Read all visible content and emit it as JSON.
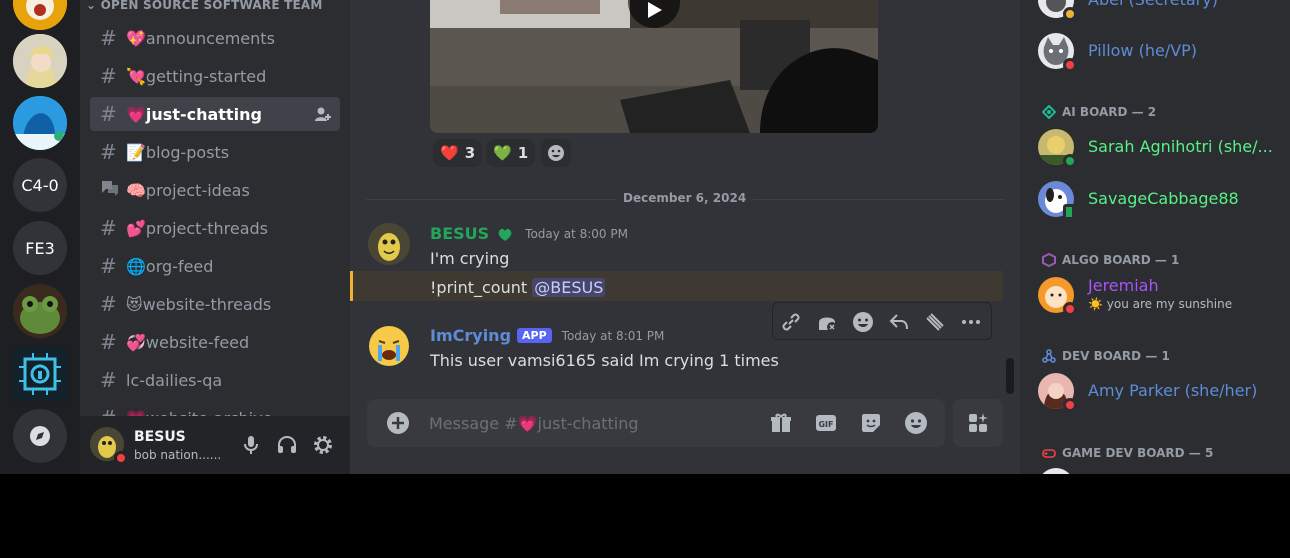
{
  "rail": {
    "servers": [
      {
        "name": "server-orange-avatar",
        "label": ""
      },
      {
        "name": "server-anime-avatar",
        "label": ""
      },
      {
        "name": "server-blue-avatar",
        "label": ""
      },
      {
        "name": "server-c40",
        "label": "C4-0"
      },
      {
        "name": "server-fe3",
        "label": "FE3"
      },
      {
        "name": "server-frog-avatar",
        "label": ""
      },
      {
        "name": "server-circuit-avatar",
        "label": ""
      }
    ]
  },
  "sidebar": {
    "category": "OPEN SOURCE SOFTWARE TEAM",
    "channels": [
      {
        "label": "💖announcements",
        "icon": "hash-icon"
      },
      {
        "label": "💘getting-started",
        "icon": "hash-icon"
      },
      {
        "label": "💗just-chatting",
        "icon": "hash-icon",
        "active": true
      },
      {
        "label": "📝blog-posts",
        "icon": "hash-icon"
      },
      {
        "label": "🧠project-ideas",
        "icon": "forum-icon"
      },
      {
        "label": "💕project-threads",
        "icon": "hash-icon"
      },
      {
        "label": "🌐org-feed",
        "icon": "hash-icon"
      },
      {
        "label": "😻website-threads",
        "icon": "hash-icon"
      },
      {
        "label": "💞website-feed",
        "icon": "hash-icon"
      },
      {
        "label": "lc-dailies-qa",
        "icon": "hash-icon"
      },
      {
        "label": "💗website-archive",
        "icon": "hash-icon"
      }
    ]
  },
  "user": {
    "name": "BESUS",
    "status": "bob nation......"
  },
  "chat": {
    "reactions": [
      {
        "emoji": "❤️",
        "count": "3"
      },
      {
        "emoji": "💚",
        "count": "1"
      }
    ],
    "date_divider": "December 6, 2024",
    "messages": [
      {
        "author": "BESUS",
        "author_color": "#23a55a",
        "timestamp": "Today at 8:00 PM",
        "lines": [
          "I'm crying",
          "!print_count"
        ],
        "mention": "@BESUS"
      },
      {
        "author": "ImCrying",
        "author_color": "#5e8cd6",
        "badge": "APP",
        "timestamp": "Today at 8:01 PM",
        "text": "This user vamsi6165 said Im crying 1 times"
      }
    ],
    "composer_placeholder": "Message #💗just-chatting"
  },
  "members": {
    "top": [
      {
        "name": "Abel (Secretary)",
        "color": "#5e8cd6"
      },
      {
        "name": "Pillow (he/VP)",
        "color": "#5e8cd6"
      }
    ],
    "groups": [
      {
        "title": "AI BOARD — 2",
        "color": "#1abc9c",
        "icon": "ai-board-icon",
        "members": [
          {
            "name": "Sarah Agnihotri (she/...",
            "color": "#57f287",
            "status": "online"
          },
          {
            "name": "SavageCabbage88",
            "color": "#57f287",
            "status": "mobile"
          }
        ]
      },
      {
        "title": "ALGO BOARD — 1",
        "color": "#9b59b6",
        "icon": "algo-board-icon",
        "members": [
          {
            "name": "Jeremiah",
            "color": "#a855f7",
            "status": "dnd",
            "sub": "☀️ you are my sunshine"
          }
        ]
      },
      {
        "title": "DEV BOARD — 1",
        "color": "#5e8cd6",
        "icon": "dev-board-icon",
        "members": [
          {
            "name": "Amy Parker (she/her)",
            "color": "#5e8cd6",
            "status": "dnd"
          }
        ]
      },
      {
        "title": "GAME DEV BOARD — 5",
        "color": "#ed4245",
        "icon": "game-dev-board-icon",
        "members": []
      }
    ]
  },
  "colors": {
    "accent": "#5865f2",
    "online": "#23a55a",
    "dnd": "#f23f43",
    "idle": "#f0b232"
  }
}
